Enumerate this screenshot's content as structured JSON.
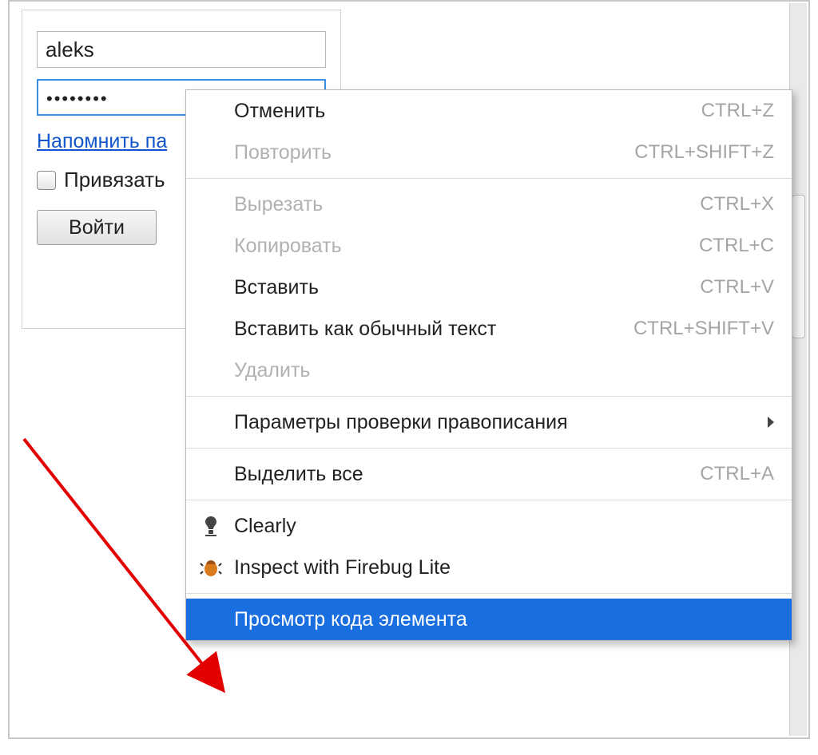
{
  "form": {
    "username_value": "aleks",
    "password_mask": "••••••••",
    "remind_link": "Напомнить па",
    "bind_label": "Привязать",
    "login_button": "Войти"
  },
  "context_menu": {
    "items": [
      {
        "label": "Отменить",
        "shortcut": "CTRL+Z",
        "enabled": true,
        "icon": "",
        "submenu": false,
        "highlighted": false
      },
      {
        "label": "Повторить",
        "shortcut": "CTRL+SHIFT+Z",
        "enabled": false,
        "icon": "",
        "submenu": false,
        "highlighted": false
      },
      {
        "sep": true
      },
      {
        "label": "Вырезать",
        "shortcut": "CTRL+X",
        "enabled": false,
        "icon": "",
        "submenu": false,
        "highlighted": false
      },
      {
        "label": "Копировать",
        "shortcut": "CTRL+C",
        "enabled": false,
        "icon": "",
        "submenu": false,
        "highlighted": false
      },
      {
        "label": "Вставить",
        "shortcut": "CTRL+V",
        "enabled": true,
        "icon": "",
        "submenu": false,
        "highlighted": false
      },
      {
        "label": "Вставить как обычный текст",
        "shortcut": "CTRL+SHIFT+V",
        "enabled": true,
        "icon": "",
        "submenu": false,
        "highlighted": false
      },
      {
        "label": "Удалить",
        "shortcut": "",
        "enabled": false,
        "icon": "",
        "submenu": false,
        "highlighted": false
      },
      {
        "sep": true
      },
      {
        "label": "Параметры проверки правописания",
        "shortcut": "",
        "enabled": true,
        "icon": "",
        "submenu": true,
        "highlighted": false
      },
      {
        "sep": true
      },
      {
        "label": "Выделить все",
        "shortcut": "CTRL+A",
        "enabled": true,
        "icon": "",
        "submenu": false,
        "highlighted": false
      },
      {
        "sep": true
      },
      {
        "label": "Clearly",
        "shortcut": "",
        "enabled": true,
        "icon": "lamp",
        "submenu": false,
        "highlighted": false
      },
      {
        "label": "Inspect with Firebug Lite",
        "shortcut": "",
        "enabled": true,
        "icon": "firebug",
        "submenu": false,
        "highlighted": false
      },
      {
        "sep": true
      },
      {
        "label": "Просмотр кода элемента",
        "shortcut": "",
        "enabled": true,
        "icon": "",
        "submenu": false,
        "highlighted": true
      }
    ]
  }
}
